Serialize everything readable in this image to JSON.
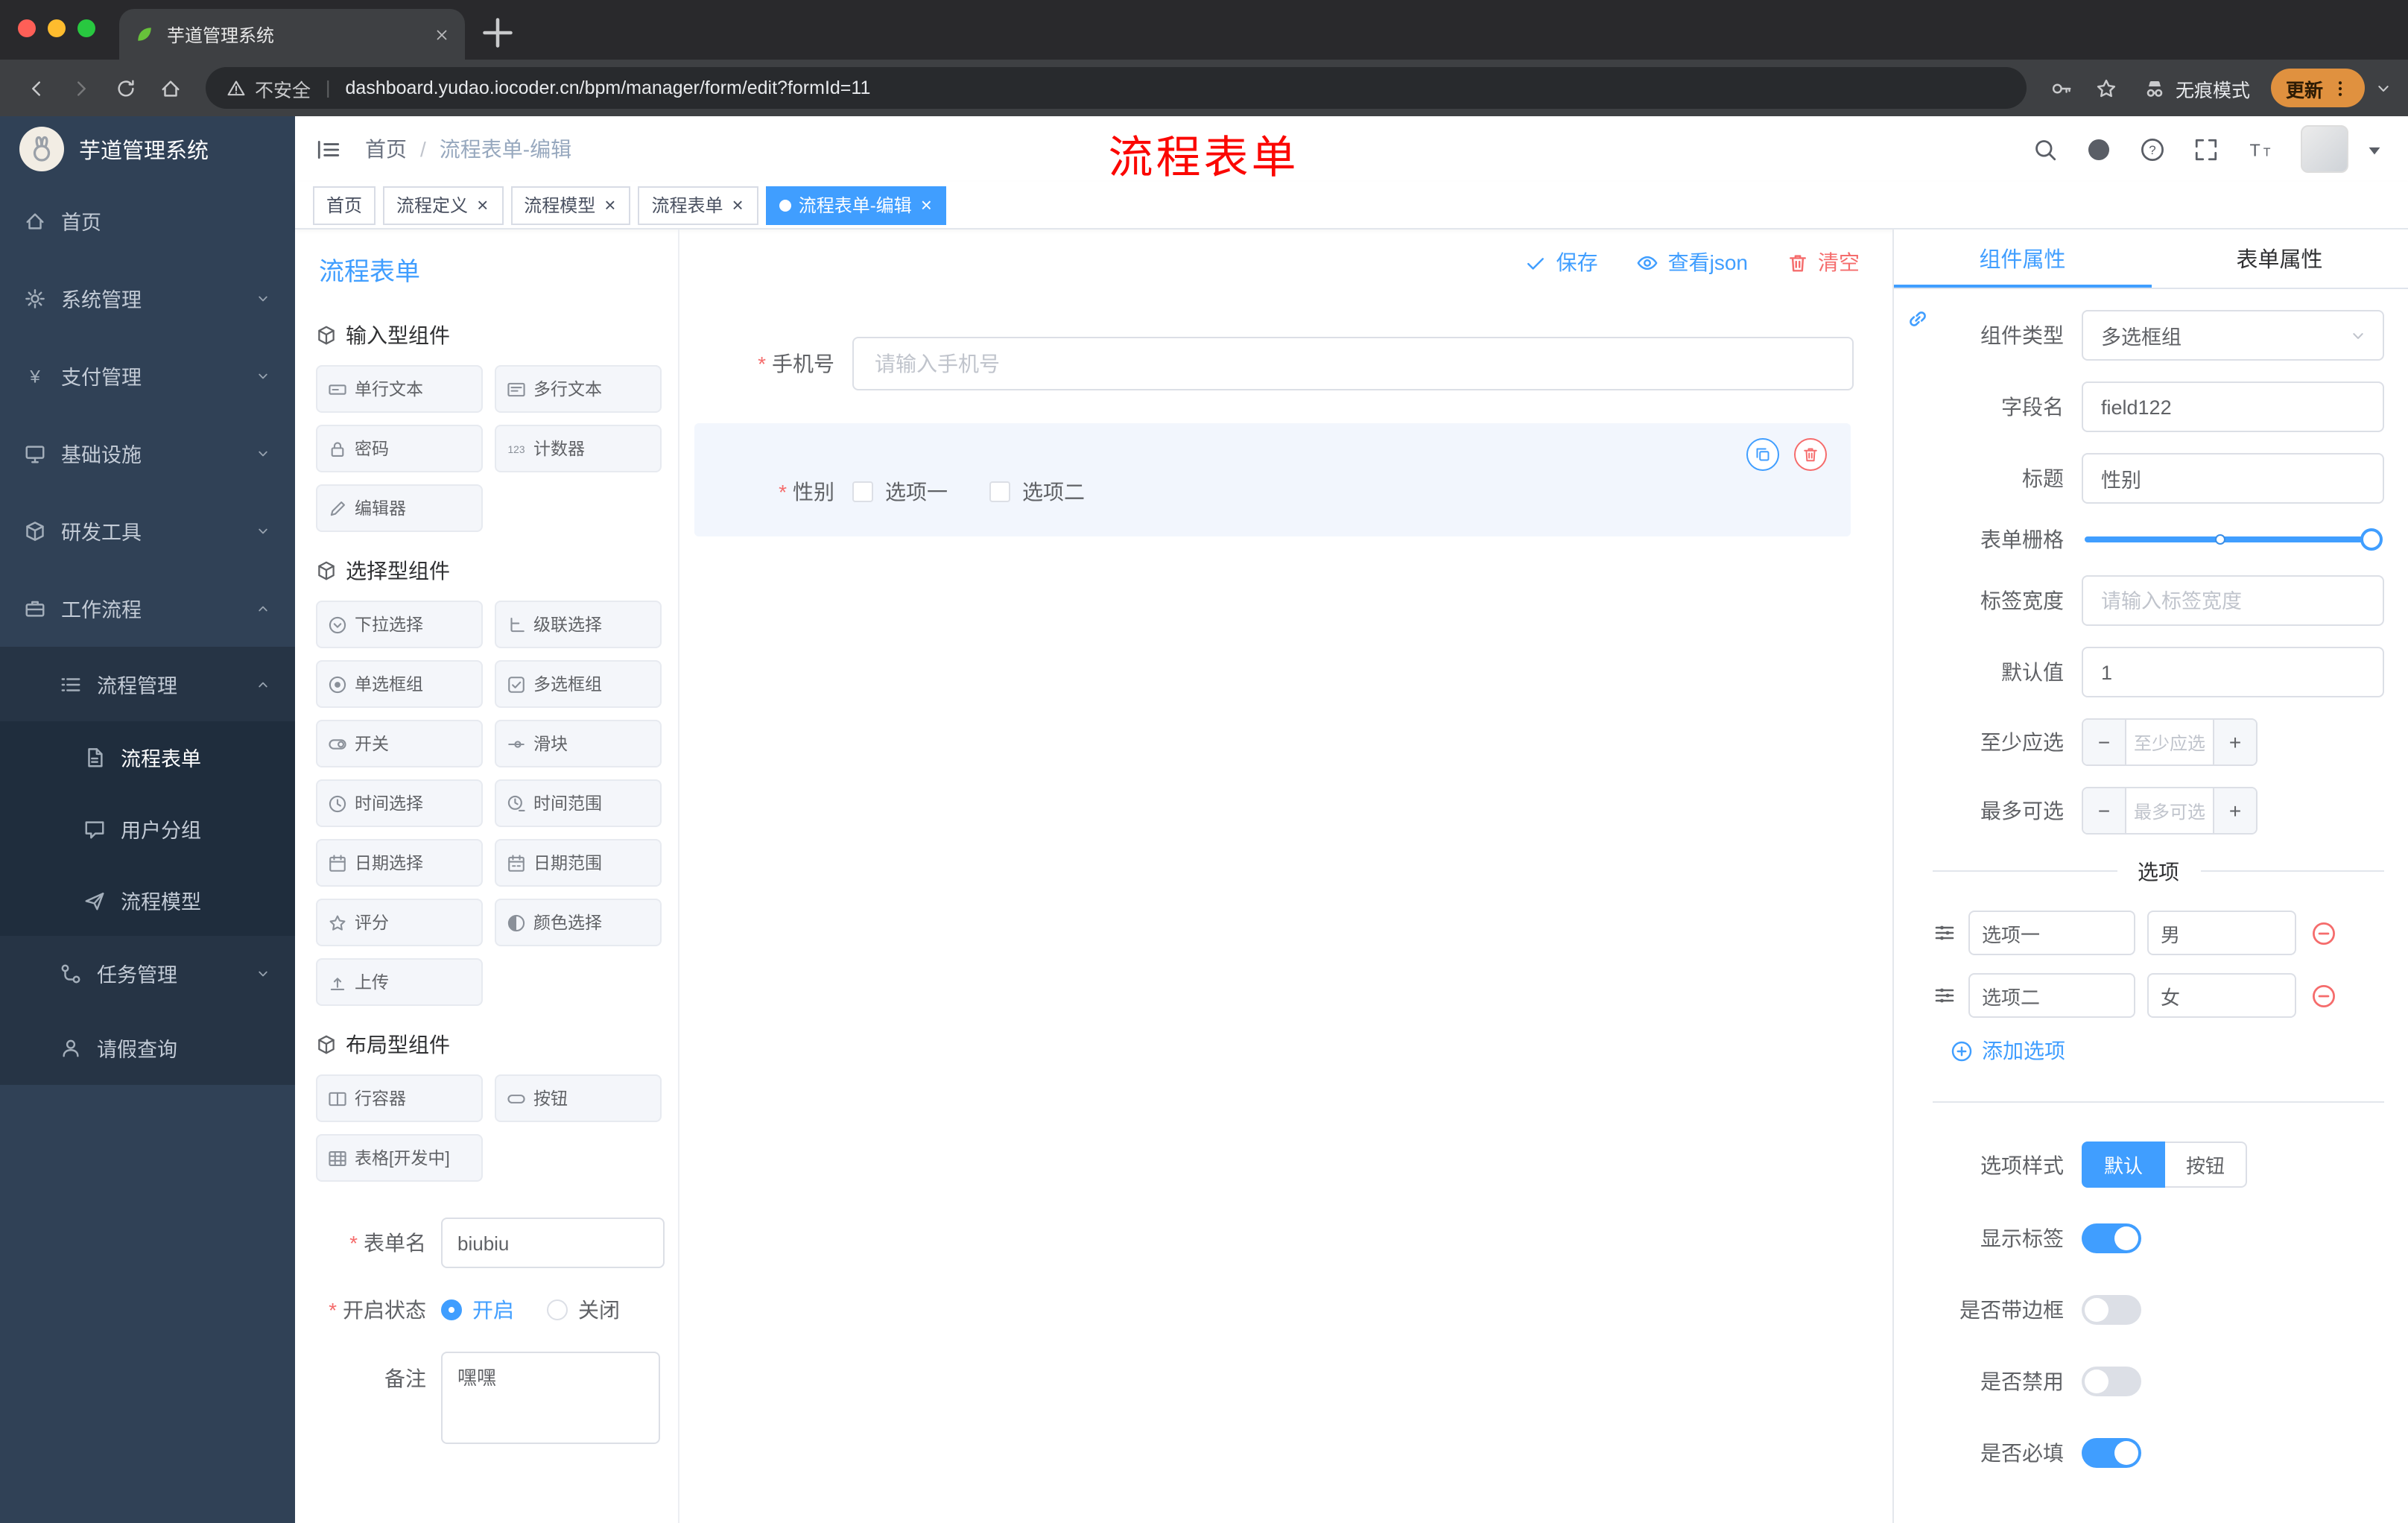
{
  "browser": {
    "tab_title": "芋道管理系统",
    "security_label": "不安全",
    "url": "dashboard.yudao.iocoder.cn/bpm/manager/form/edit?formId=11",
    "incognito_label": "无痕模式",
    "update_label": "更新"
  },
  "annotation": {
    "text": "流程表单",
    "color": "#fb0702"
  },
  "sidebar": {
    "logo_title": "芋道管理系统",
    "items": [
      {
        "label": "首页",
        "icon": "home",
        "level": 1
      },
      {
        "label": "系统管理",
        "icon": "gear",
        "level": 1,
        "arrow": "down"
      },
      {
        "label": "支付管理",
        "icon": "yen",
        "level": 1,
        "arrow": "down"
      },
      {
        "label": "基础设施",
        "icon": "monitor",
        "level": 1,
        "arrow": "down"
      },
      {
        "label": "研发工具",
        "icon": "box",
        "level": 1,
        "arrow": "down"
      },
      {
        "label": "工作流程",
        "icon": "briefcase",
        "level": 1,
        "arrow": "up"
      },
      {
        "label": "流程管理",
        "icon": "list",
        "level": 2,
        "arrow": "up"
      },
      {
        "label": "流程表单",
        "icon": "doc",
        "level": 3,
        "current": true
      },
      {
        "label": "用户分组",
        "icon": "chat",
        "level": 3
      },
      {
        "label": "流程模型",
        "icon": "send",
        "level": 3
      },
      {
        "label": "任务管理",
        "icon": "flow",
        "level": 2,
        "arrow": "down"
      },
      {
        "label": "请假查询",
        "icon": "user",
        "level": 2
      }
    ]
  },
  "header": {
    "breadcrumb": [
      "首页",
      "流程表单-编辑"
    ]
  },
  "tags": [
    {
      "label": "首页",
      "closable": false,
      "active": false
    },
    {
      "label": "流程定义",
      "closable": true,
      "active": false
    },
    {
      "label": "流程模型",
      "closable": true,
      "active": false
    },
    {
      "label": "流程表单",
      "closable": true,
      "active": false
    },
    {
      "label": "流程表单-编辑",
      "closable": true,
      "active": true
    }
  ],
  "designer": {
    "title": "流程表单",
    "actions": {
      "save": "保存",
      "view_json": "查看json",
      "clear": "清空"
    },
    "groups": [
      {
        "title": "输入型组件",
        "items": [
          {
            "label": "单行文本",
            "icon": "textline"
          },
          {
            "label": "多行文本",
            "icon": "textarea"
          },
          {
            "label": "密码",
            "icon": "lock"
          },
          {
            "label": "计数器",
            "icon": "counter"
          },
          {
            "label": "编辑器",
            "icon": "editor"
          }
        ]
      },
      {
        "title": "选择型组件",
        "items": [
          {
            "label": "下拉选择",
            "icon": "select"
          },
          {
            "label": "级联选择",
            "icon": "cascader"
          },
          {
            "label": "单选框组",
            "icon": "radio"
          },
          {
            "label": "多选框组",
            "icon": "checkbox"
          },
          {
            "label": "开关",
            "icon": "switch"
          },
          {
            "label": "滑块",
            "icon": "slider"
          },
          {
            "label": "时间选择",
            "icon": "time"
          },
          {
            "label": "时间范围",
            "icon": "timerange"
          },
          {
            "label": "日期选择",
            "icon": "date"
          },
          {
            "label": "日期范围",
            "icon": "daterange"
          },
          {
            "label": "评分",
            "icon": "star"
          },
          {
            "label": "颜色选择",
            "icon": "color"
          },
          {
            "label": "上传",
            "icon": "upload"
          }
        ]
      },
      {
        "title": "布局型组件",
        "items": [
          {
            "label": "行容器",
            "icon": "rowbox"
          },
          {
            "label": "按钮",
            "icon": "btn"
          },
          {
            "label": "表格[开发中]",
            "icon": "table"
          }
        ]
      }
    ],
    "form": {
      "name_label": "表单名",
      "name_value": "biubiu",
      "status_label": "开启状态",
      "status_options": [
        "开启",
        "关闭"
      ],
      "status_selected": "开启",
      "remark_label": "备注",
      "remark_value": "嘿嘿"
    }
  },
  "canvas": {
    "phone": {
      "label": "手机号",
      "placeholder": "请输入手机号",
      "required": true
    },
    "gender": {
      "label": "性别",
      "options": [
        "选项一",
        "选项二"
      ],
      "required": true
    }
  },
  "properties": {
    "tabs": [
      "组件属性",
      "表单属性"
    ],
    "active_tab": "组件属性",
    "fields": {
      "component_type": {
        "label": "组件类型",
        "value": "多选框组"
      },
      "field_name": {
        "label": "字段名",
        "value": "field122"
      },
      "title": {
        "label": "标题",
        "value": "性别"
      },
      "grid": {
        "label": "表单栅格"
      },
      "label_width": {
        "label": "标签宽度",
        "placeholder": "请输入标签宽度"
      },
      "default_value": {
        "label": "默认值",
        "value": "1"
      },
      "min_select": {
        "label": "至少应选",
        "placeholder": "至少应选"
      },
      "max_select": {
        "label": "最多可选",
        "placeholder": "最多可选"
      }
    },
    "options_section_title": "选项",
    "options": [
      {
        "label": "选项一",
        "value": "男"
      },
      {
        "label": "选项二",
        "value": "女"
      }
    ],
    "add_option_label": "添加选项",
    "option_style": {
      "label": "选项样式",
      "buttons": [
        "默认",
        "按钮"
      ],
      "active": "默认"
    },
    "switches": [
      {
        "label": "显示标签",
        "on": true
      },
      {
        "label": "是否带边框",
        "on": false
      },
      {
        "label": "是否禁用",
        "on": false
      },
      {
        "label": "是否必填",
        "on": true
      }
    ]
  },
  "colors": {
    "primary": "#409EFF",
    "danger": "#F56C6C",
    "sidebar_bg": "#304156",
    "tag_active": "#409EFF"
  }
}
